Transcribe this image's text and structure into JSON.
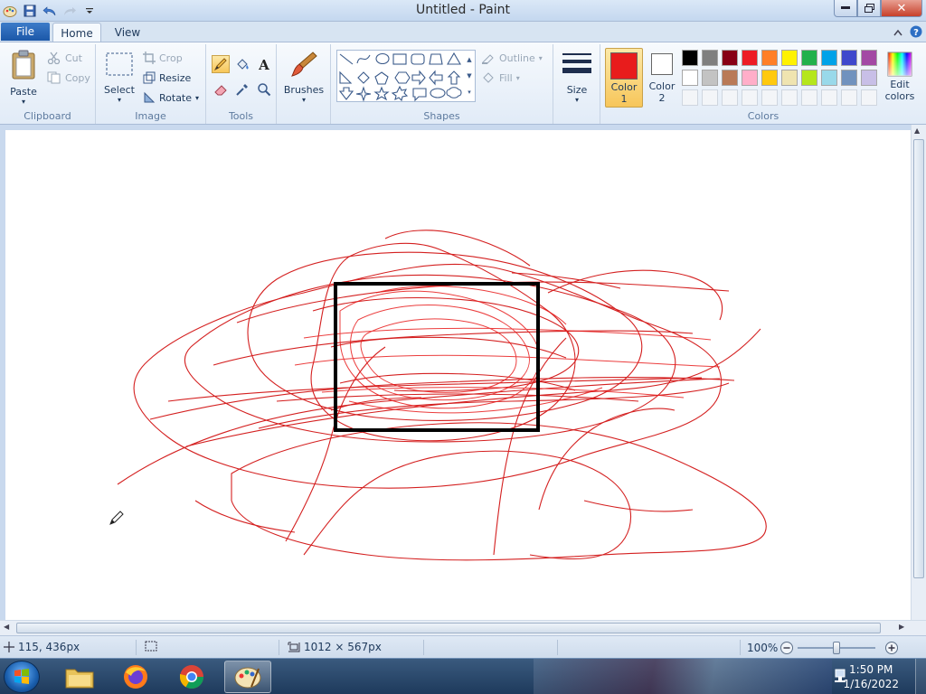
{
  "window": {
    "title": "Untitled - Paint"
  },
  "tabs": {
    "file": "File",
    "home": "Home",
    "view": "View"
  },
  "clipboard": {
    "paste": "Paste",
    "cut": "Cut",
    "copy": "Copy",
    "label": "Clipboard"
  },
  "image": {
    "select": "Select",
    "crop": "Crop",
    "resize": "Resize",
    "rotate": "Rotate",
    "label": "Image"
  },
  "tools": {
    "label": "Tools"
  },
  "brushes": {
    "label": "Brushes"
  },
  "shapes": {
    "label": "Shapes",
    "outline": "Outline",
    "fill": "Fill"
  },
  "size": {
    "label": "Size"
  },
  "colors": {
    "color1_label": "Color 1",
    "color1_value": "#e81c1c",
    "color2_label": "Color 2",
    "color2_value": "#ffffff",
    "edit_label": "Edit colors",
    "label": "Colors",
    "palette_row1": [
      "#000000",
      "#7f7f7f",
      "#880015",
      "#ed1c24",
      "#ff7f27",
      "#fff200",
      "#22b14c",
      "#00a2e8",
      "#3f48cc",
      "#a349a4"
    ],
    "palette_row2": [
      "#ffffff",
      "#c3c3c3",
      "#b97a57",
      "#ffaec9",
      "#ffc90e",
      "#efe4b0",
      "#b5e61d",
      "#99d9ea",
      "#7092be",
      "#c8bfe7"
    ]
  },
  "status": {
    "cursor_pos": "115, 436px",
    "canvas_size": "1012 × 567px",
    "zoom": "100%"
  },
  "taskbar": {
    "time": "1:50 PM",
    "date": "1/16/2022"
  }
}
